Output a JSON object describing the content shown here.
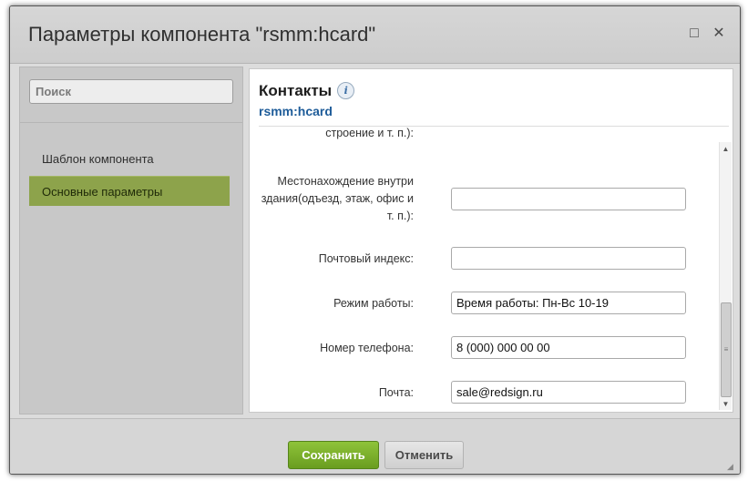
{
  "window": {
    "title": "Параметры компонента \"rsmm:hcard\"",
    "maximize_glyph": "□",
    "close_glyph": "✕"
  },
  "sidebar": {
    "search_placeholder": "Поиск",
    "items": [
      {
        "label": "Шаблон компонента",
        "active": false
      },
      {
        "label": "Основные параметры",
        "active": true
      }
    ]
  },
  "content": {
    "title": "Контакты",
    "subtitle": "rsmm:hcard",
    "info_glyph": "i",
    "fields": [
      {
        "label": "строение и т. п.):",
        "value": ""
      },
      {
        "label": "Местонахождение внутри здания(одъезд, этаж, офис и т. п.):",
        "value": ""
      },
      {
        "label": "Почтовый индекс:",
        "value": ""
      },
      {
        "label": "Режим работы:",
        "value": "Время работы: Пн-Вс 10-19"
      },
      {
        "label": "Номер телефона:",
        "value": "8 (000) 000 00 00"
      },
      {
        "label": "Почта:",
        "value": "sale@redsign.ru"
      }
    ]
  },
  "footer": {
    "save_label": "Сохранить",
    "cancel_label": "Отменить"
  },
  "colors": {
    "accent_green": "#6a9d1f",
    "active_nav": "#8da34b",
    "link_blue": "#1e5c99"
  },
  "icons": [
    "maximize-icon",
    "close-icon",
    "info-icon",
    "scroll-up-icon",
    "scroll-down-icon",
    "resize-grip-icon"
  ]
}
